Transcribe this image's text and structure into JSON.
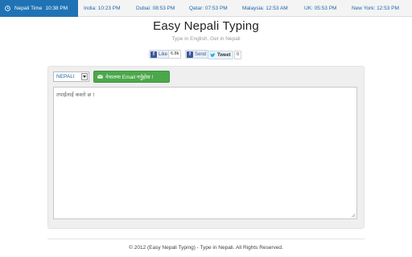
{
  "top_bar": {
    "nepali_time": {
      "label": "Nepali Time",
      "time": "10:38 PM"
    },
    "cities": [
      {
        "name": "India",
        "time": "10:23 PM",
        "text": "India: 10:23 PM"
      },
      {
        "name": "Dubai",
        "time": "08:53 PM",
        "text": "Dubai: 08:53 PM"
      },
      {
        "name": "Qatar",
        "time": "07:53 PM",
        "text": "Qatar: 07:53 PM"
      },
      {
        "name": "Malaysia",
        "time": "12:53 AM",
        "text": "Malaysia: 12:53 AM"
      },
      {
        "name": "UK",
        "time": "05:53 PM",
        "text": "UK: 05:53 PM"
      },
      {
        "name": "New York",
        "time": "12:53 PM",
        "text": "New York: 12:53 PM"
      }
    ]
  },
  "header": {
    "title": "Easy Nepali Typing",
    "subtitle": "Type in English, Get in Nepali"
  },
  "social": {
    "like_label": "Like",
    "like_count": "6.8k",
    "send_label": "Send",
    "tweet_label": "Tweet",
    "tweet_count": "0"
  },
  "editor": {
    "language_select": "NEPALI",
    "email_button": "नेपालमा Email गर्नुहोस !",
    "text": "तपाईंलाई कस्तो छ !"
  },
  "footer": {
    "text": "© 2012 (Easy Nepali Typing) - Type in Nepali. All Rights Reserved."
  },
  "colors": {
    "accent_blue": "#1f73b5",
    "link_blue": "#1f66a8",
    "email_green": "#4aa84a",
    "facebook": "#3b5998"
  },
  "icons": {
    "nepali_time": "clock-icon",
    "email_button": "envelope-icon",
    "like": "facebook-icon",
    "send": "facebook-icon",
    "tweet": "twitter-bird-icon",
    "select": "chevron-down-icon",
    "textarea": "resize-grip-icon"
  }
}
